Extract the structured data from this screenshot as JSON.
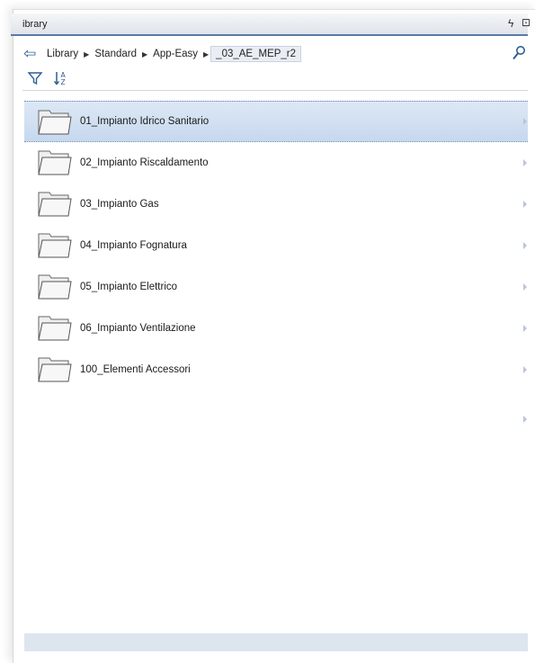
{
  "panel": {
    "title": "ibrary",
    "pin_glyph": "ϟ",
    "undock_glyph": "⊡"
  },
  "breadcrumb": {
    "back_icon": "arrow-back-icon",
    "items": [
      "Library",
      "Standard",
      "App-Easy",
      "_03_AE_MEP_r2"
    ],
    "separator": "▶",
    "search_icon": "search-icon"
  },
  "toolbar": {
    "filter_icon": "filter-icon",
    "sort_icon": "sort-az-icon"
  },
  "folders": [
    {
      "label": "01_Impianto Idrico Sanitario",
      "selected": true
    },
    {
      "label": "02_Impianto Riscaldamento",
      "selected": false
    },
    {
      "label": "03_Impianto Gas",
      "selected": false
    },
    {
      "label": "04_Impianto Fognatura",
      "selected": false
    },
    {
      "label": "05_Impianto Elettrico",
      "selected": false
    },
    {
      "label": "06_Impianto Ventilazione",
      "selected": false
    },
    {
      "label": "100_Elementi Accessori",
      "selected": false
    }
  ],
  "colors": {
    "accent": "#5a7aa1",
    "selection": "#c6d8ee",
    "statusbar": "#dde5ef"
  }
}
